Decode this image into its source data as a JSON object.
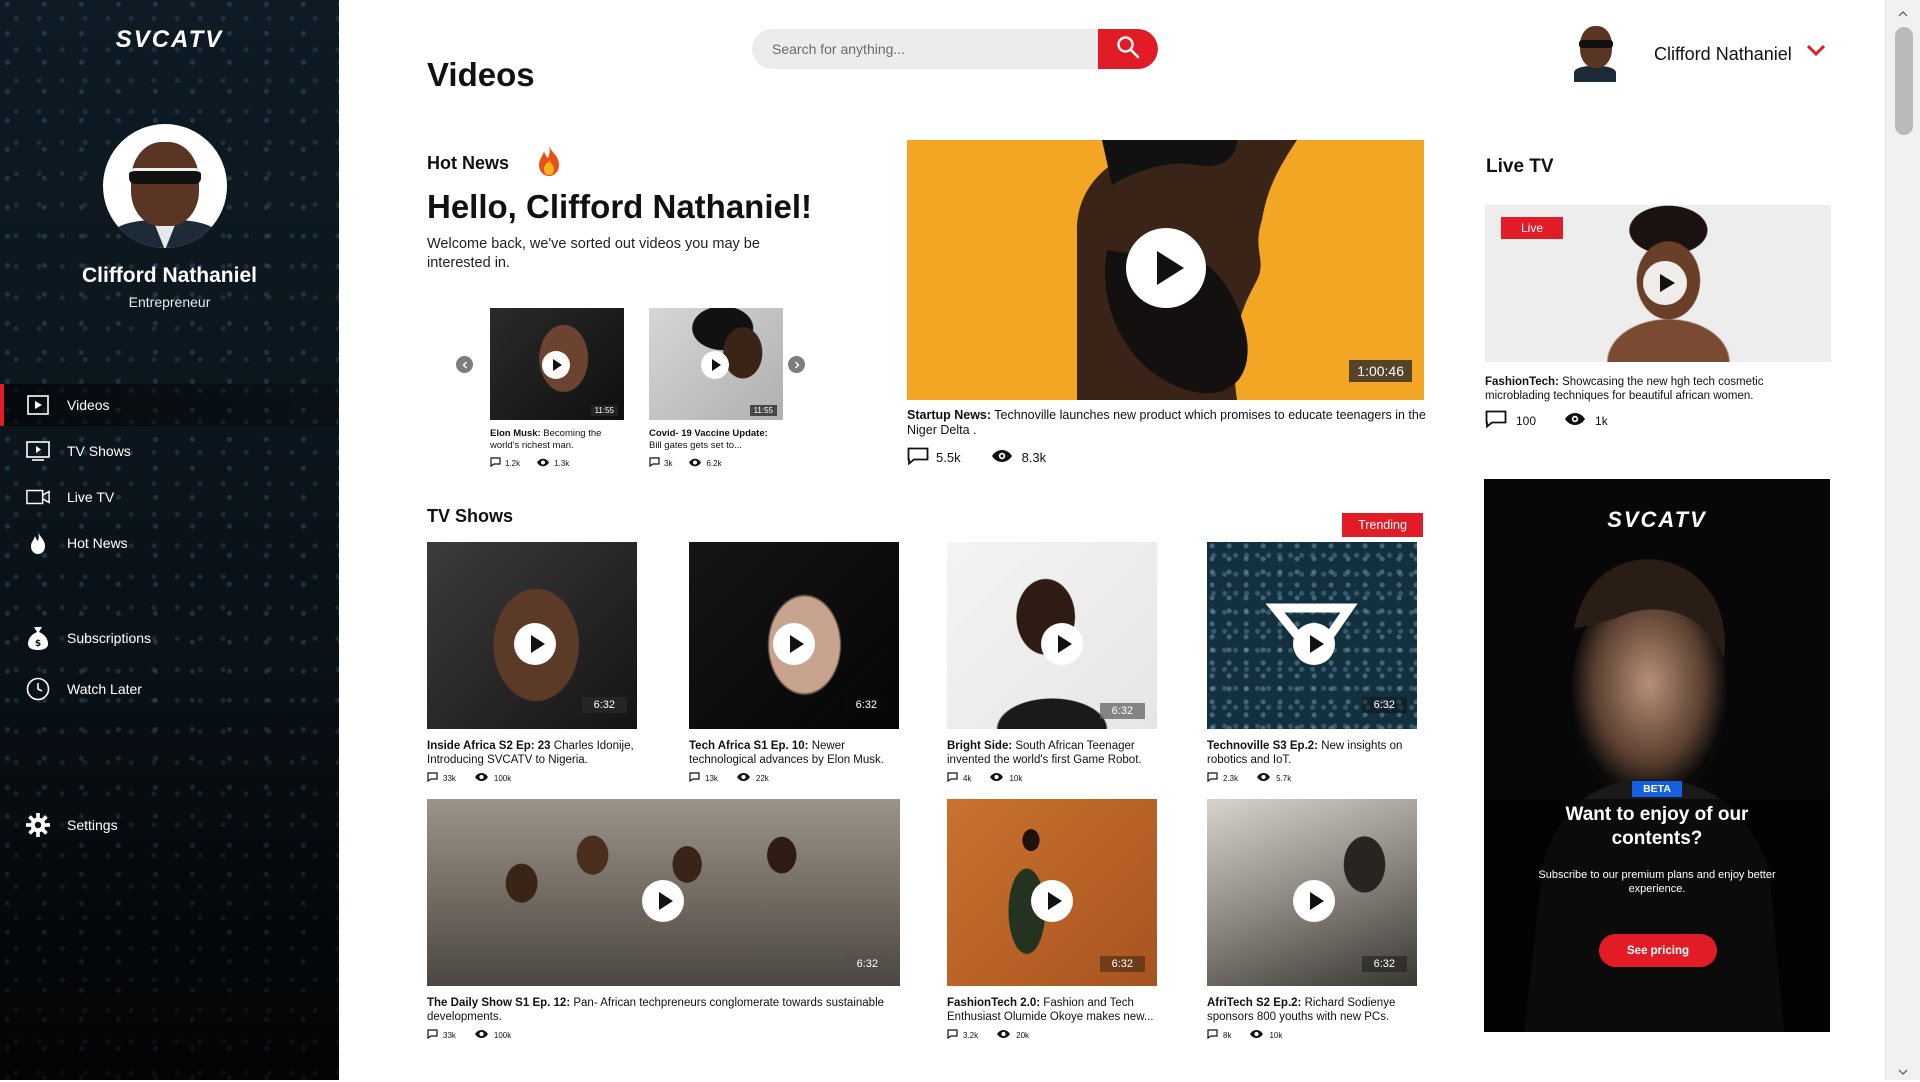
{
  "app": {
    "logo": "SVCATV"
  },
  "sidebar": {
    "user_name": "Clifford Nathaniel",
    "user_role": "Entrepreneur",
    "items": [
      {
        "label": "Videos",
        "icon": "play-square-icon",
        "active": true
      },
      {
        "label": "TV Shows",
        "icon": "tv-play-icon"
      },
      {
        "label": "Live TV",
        "icon": "video-camera-icon"
      },
      {
        "label": "Hot News",
        "icon": "flame-icon"
      },
      {
        "label": "Subscriptions",
        "icon": "money-bag-icon"
      },
      {
        "label": "Watch Later",
        "icon": "clock-icon"
      },
      {
        "label": "Settings",
        "icon": "gear-icon"
      }
    ]
  },
  "header": {
    "page_title": "Videos",
    "search_placeholder": "Search for anything...",
    "user_name": "Clifford Nathaniel"
  },
  "hot_news": {
    "label": "Hot News",
    "greeting": "Hello, Clifford Nathaniel!",
    "welcome": "Welcome back, we've sorted out videos you may be interested in.",
    "carousel": [
      {
        "lead": "Elon Musk:",
        "text": " Becoming the world's richest man.",
        "duration": "11:55",
        "comments": "1.2k",
        "views": "1.3k"
      },
      {
        "lead": "Covid- 19 Vaccine Update:",
        "text": " Bill  gates gets set to...",
        "duration": "11:55",
        "comments": "3k",
        "views": "6.2k"
      }
    ],
    "featured": {
      "duration": "1:00:46",
      "lead": "Startup News:",
      "text": " Technoville launches new product which promises to educate teenagers in the Niger Delta .",
      "comments": "5.5k",
      "views": "8.3k"
    }
  },
  "tv_shows": {
    "label": "TV Shows",
    "badge": "Trending",
    "cards": [
      {
        "lead": "Inside Africa S2 Ep: 23",
        "text": " Charles Idonije, Introducing SVCATV to Nigeria.",
        "duration": "6:32",
        "comments": "33k",
        "views": "100k"
      },
      {
        "lead": "Tech Africa S1 Ep. 10:",
        "text": " Newer technological advances by Elon Musk.",
        "duration": "6:32",
        "comments": "13k",
        "views": "22k"
      },
      {
        "lead": "Bright Side:",
        "text": " South African Teenager invented the world's first Game Robot.",
        "duration": "6:32",
        "comments": "4k",
        "views": "10k"
      },
      {
        "lead": "Technoville S3 Ep.2:",
        "text": " New insights on robotics and IoT.",
        "duration": "6:32",
        "comments": "2.3k",
        "views": "5.7k"
      },
      {
        "lead": "The Daily Show S1 Ep. 12:",
        "text": " Pan- African techpreneurs conglomerate towards sustainable developments.",
        "duration": "6:32",
        "comments": "33k",
        "views": "100k"
      },
      {
        "lead": "FashionTech 2.0:",
        "text": " Fashion and Tech Enthusiast Olumide Okoye makes new...",
        "duration": "6:32",
        "comments": "3.2k",
        "views": "20k"
      },
      {
        "lead": "AfriTech S2 Ep.2:",
        "text": " Richard Sodienye sponsors 800 youths with new PCs.",
        "duration": "6:32",
        "comments": "8k",
        "views": "10k"
      }
    ]
  },
  "live_tv": {
    "label": "Live TV",
    "badge": "Live",
    "lead": "FashionTech:",
    "text": " Showcasing the new hgh tech cosmetic microblading techniques for beautiful african women.",
    "comments": "100",
    "views": "1k"
  },
  "promo": {
    "logo": "SVCATV",
    "badge": "BETA",
    "title": "Want to enjoy of our contents?",
    "text": "Subscribe to our premium plans and enjoy better experience.",
    "button": "See pricing"
  },
  "colors": {
    "accent": "#e21c26",
    "sidebar_bg": "#0b141b",
    "beta_blue": "#1460e0",
    "feature_bg": "#f2a624"
  }
}
